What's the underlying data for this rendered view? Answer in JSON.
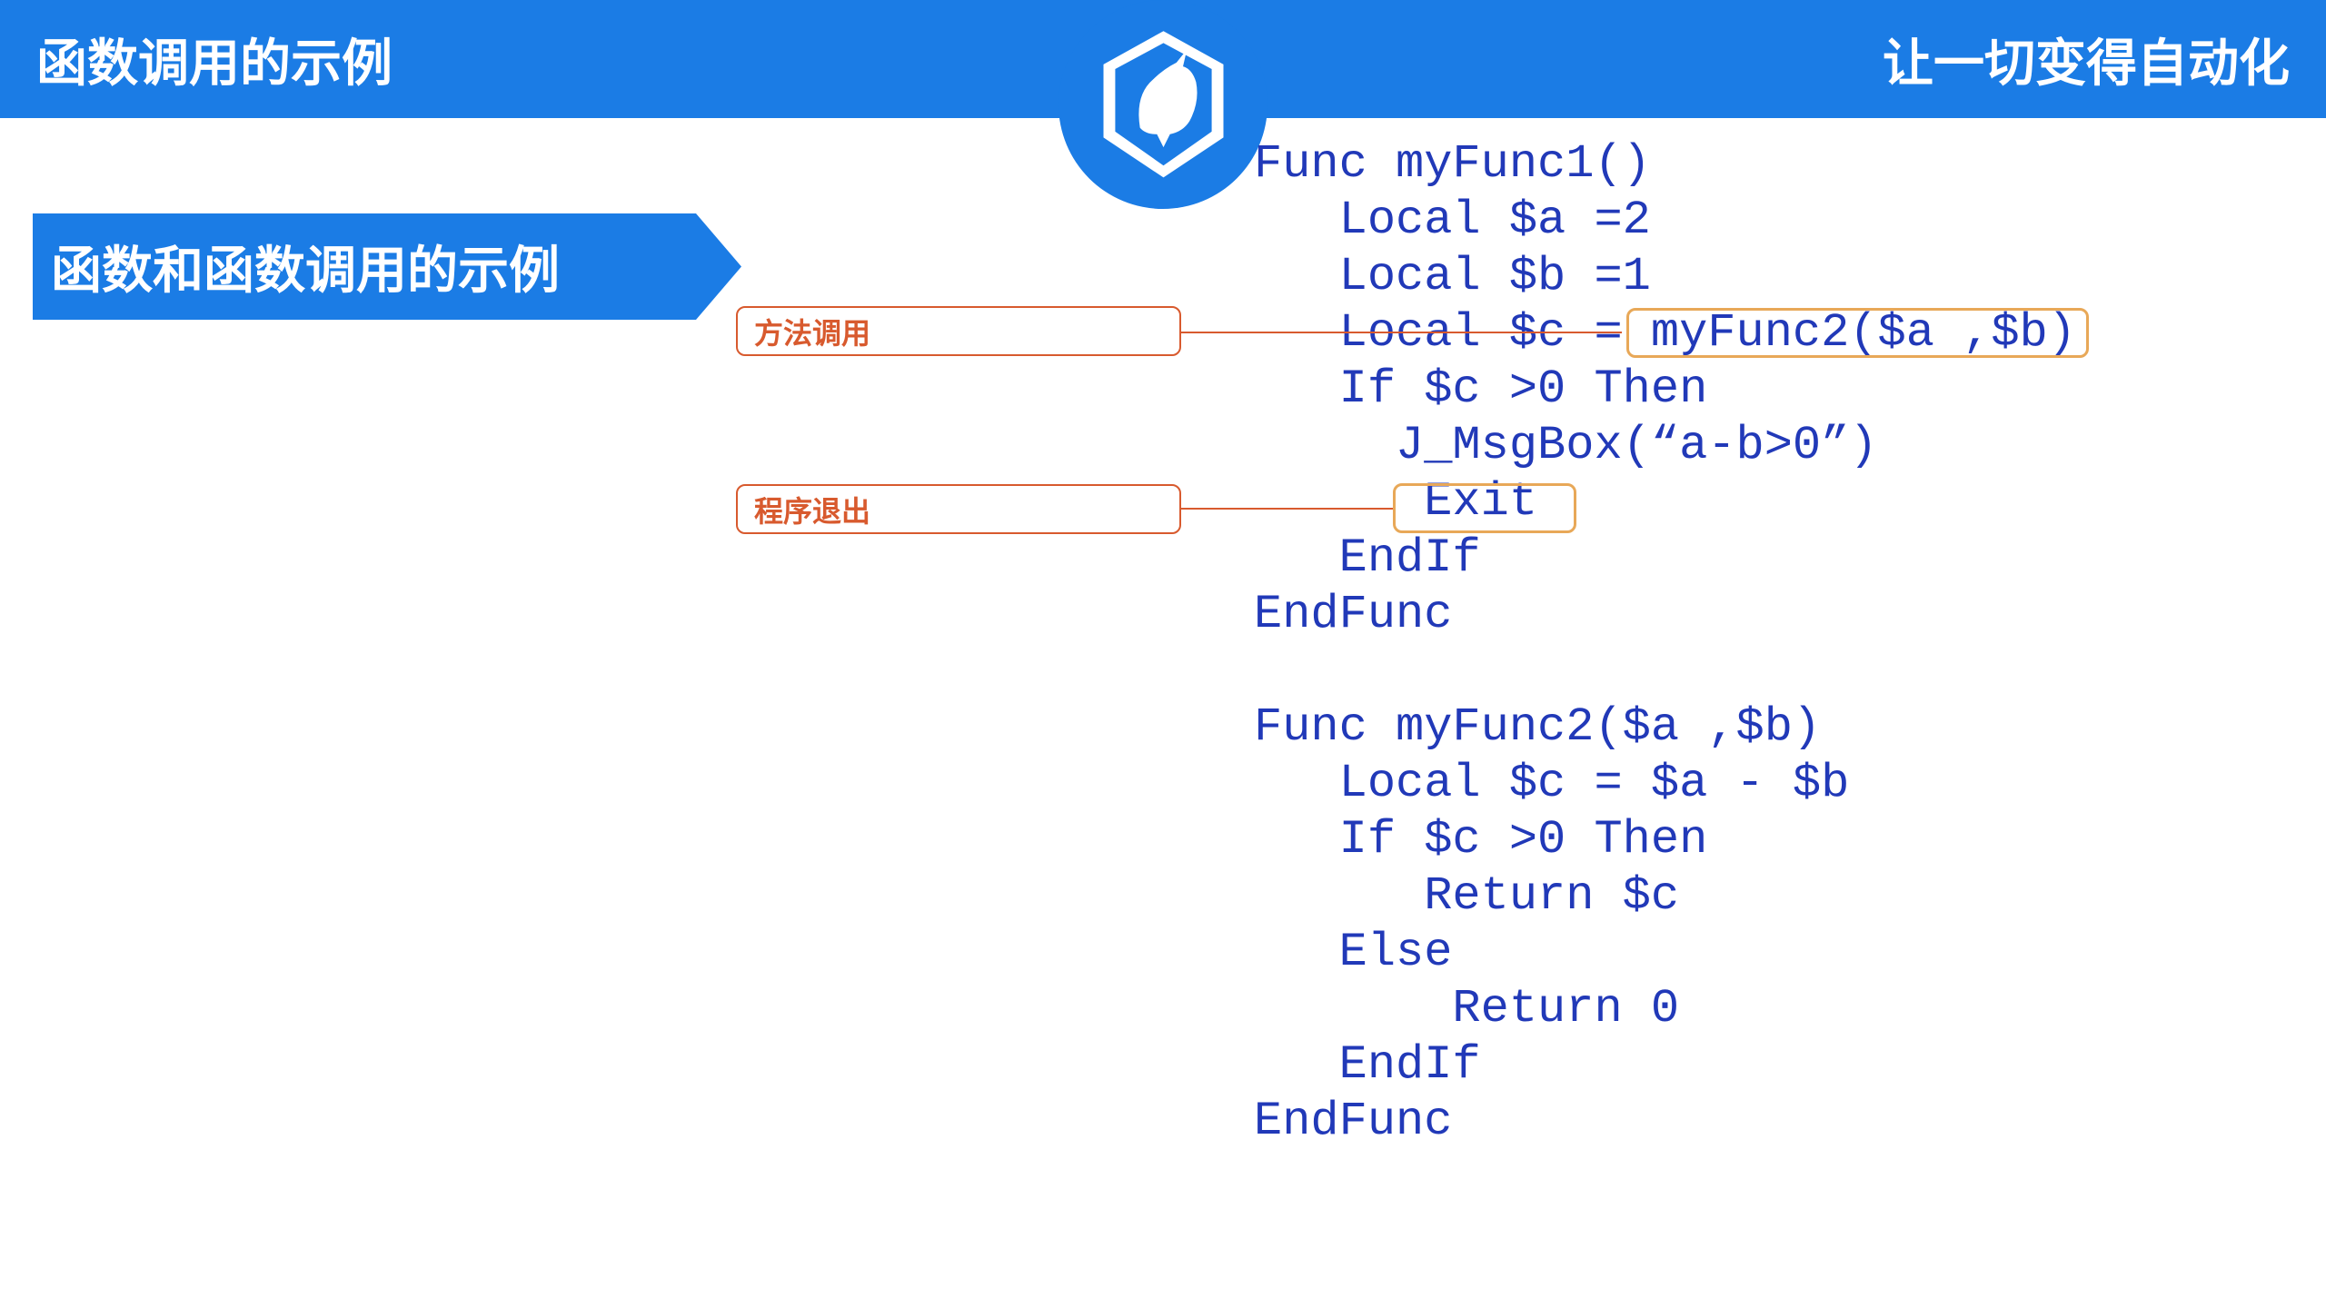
{
  "header": {
    "left": "函数调用的示例",
    "right": "让一切变得自动化"
  },
  "section_title": "函数和函数调用的示例",
  "code": "Func myFunc1()\n   Local $a =2\n   Local $b =1\n   Local $c = myFunc2($a ,$b)\n   If $c >0 Then\n     J_MsgBox(“a-b>0”)\n      Exit\n   EndIf\nEndFunc\n\nFunc myFunc2($a ,$b)\n   Local $c = $a - $b\n   If $c >0 Then\n      Return $c\n   Else\n       Return 0\n   EndIf\nEndFunc",
  "annotations": {
    "method_call": "方法调用",
    "program_exit": "程序退出"
  }
}
